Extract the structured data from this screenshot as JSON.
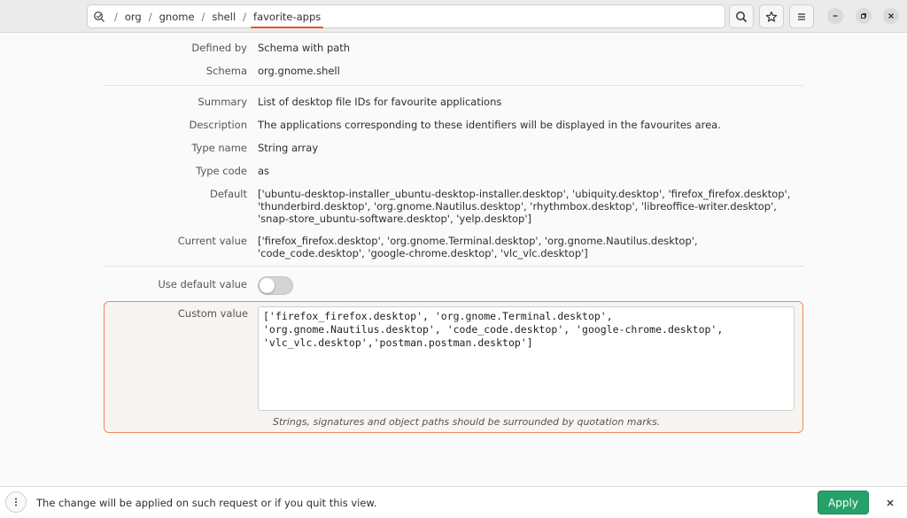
{
  "header": {
    "path": [
      "org",
      "gnome",
      "shell",
      "favorite-apps"
    ],
    "separator": "/"
  },
  "properties": {
    "defined_by": {
      "label": "Defined by",
      "value": "Schema with path"
    },
    "schema": {
      "label": "Schema",
      "value": "org.gnome.shell"
    },
    "summary": {
      "label": "Summary",
      "value": "List of desktop file IDs for favourite applications"
    },
    "description": {
      "label": "Description",
      "value": "The applications corresponding to these identifiers will be displayed in the favourites area."
    },
    "type_name": {
      "label": "Type name",
      "value": "String array"
    },
    "type_code": {
      "label": "Type code",
      "value": "as"
    },
    "default": {
      "label": "Default",
      "value": "['ubuntu-desktop-installer_ubuntu-desktop-installer.desktop', 'ubiquity.desktop', 'firefox_firefox.desktop', 'thunderbird.desktop', 'org.gnome.Nautilus.desktop', 'rhythmbox.desktop', 'libreoffice-writer.desktop', 'snap-store_ubuntu-software.desktop', 'yelp.desktop']"
    },
    "current_value": {
      "label": "Current value",
      "value": "['firefox_firefox.desktop', 'org.gnome.Terminal.desktop', 'org.gnome.Nautilus.desktop', 'code_code.desktop', 'google-chrome.desktop', 'vlc_vlc.desktop']"
    }
  },
  "use_default": {
    "label": "Use default value",
    "enabled": false
  },
  "custom_value": {
    "label": "Custom value",
    "text": "['firefox_firefox.desktop', 'org.gnome.Terminal.desktop',\n'org.gnome.Nautilus.desktop', 'code_code.desktop', 'google-chrome.desktop',\n'vlc_vlc.desktop','postman.postman.desktop']",
    "hint": "Strings, signatures and object paths should be surrounded by quotation marks."
  },
  "bottom": {
    "message": "The change will be applied on such request or if you quit this view.",
    "apply_label": "Apply"
  },
  "colors": {
    "accent": "#e95420",
    "apply": "#26a269",
    "error_border": "#f08a5d"
  }
}
